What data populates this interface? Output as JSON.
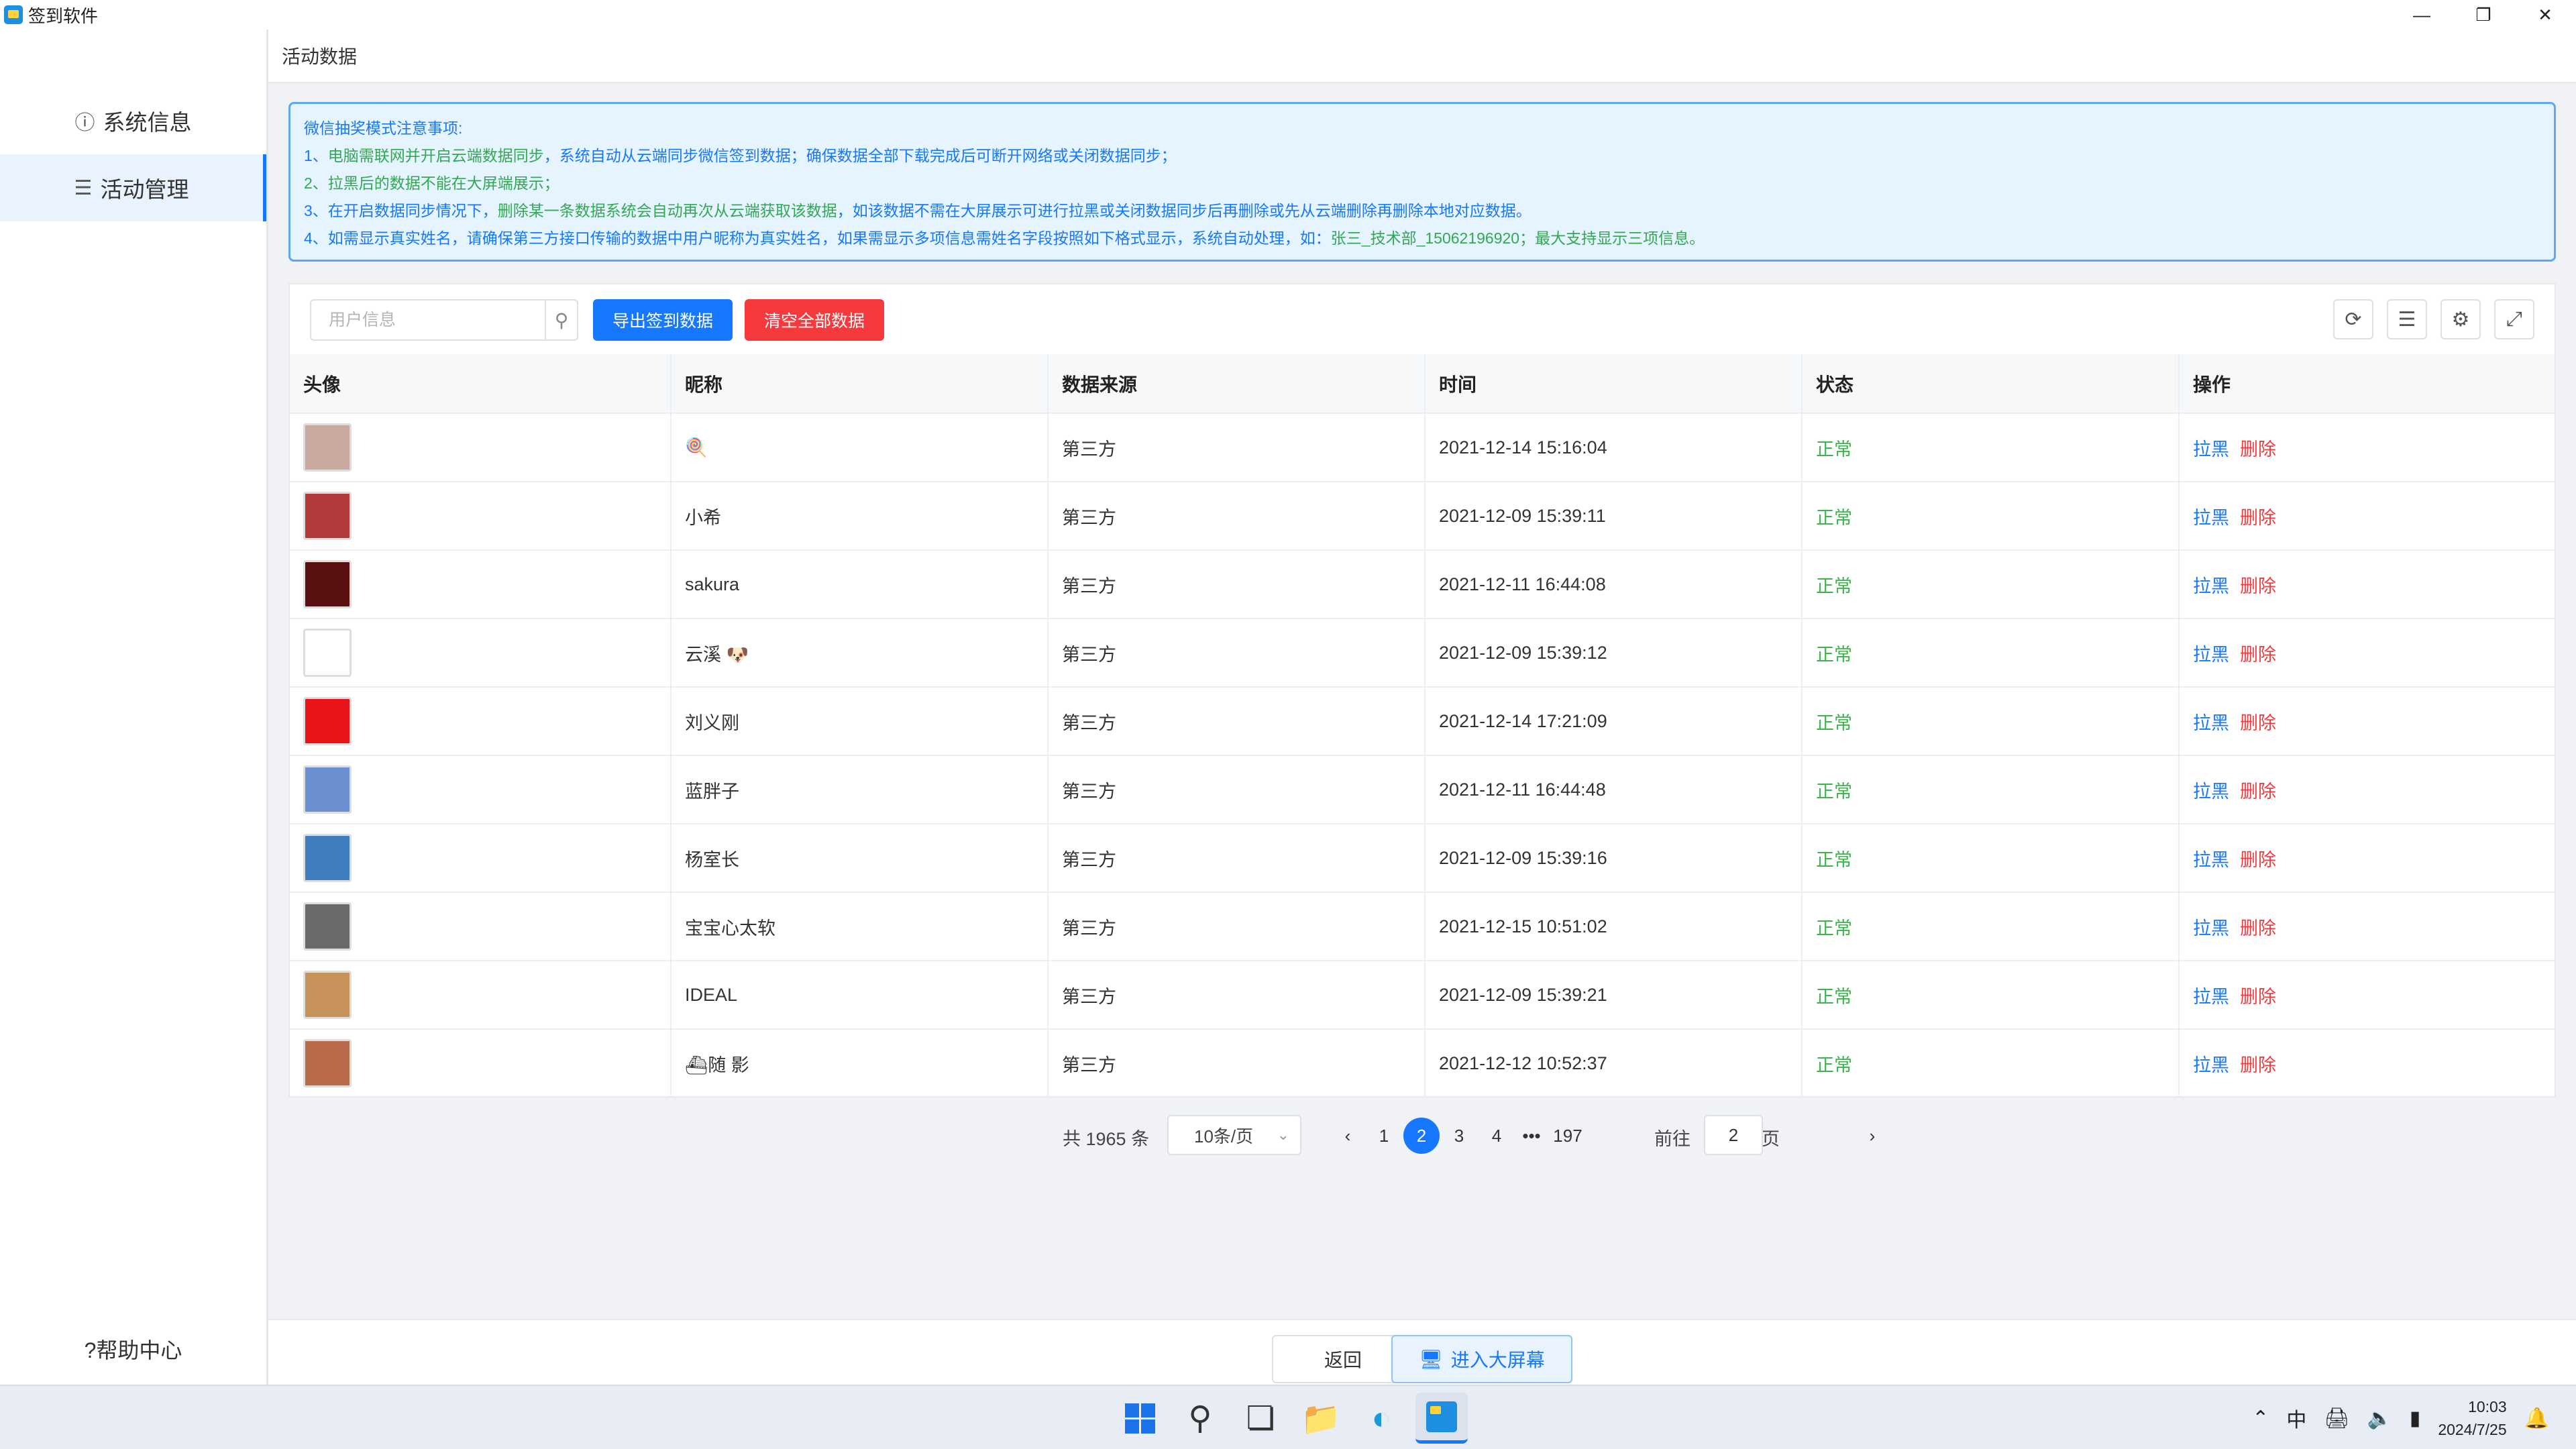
{
  "app": {
    "title": "签到软件"
  },
  "sidebar": {
    "items": [
      {
        "label": "系统信息",
        "icon": "info-icon"
      },
      {
        "label": "活动管理",
        "icon": "list-icon"
      }
    ],
    "help": "?帮助中心"
  },
  "breadcrumb": "活动数据",
  "notice": {
    "title": "微信抽奖模式注意事项:",
    "line1_a": "1、",
    "line1_b": "电脑需联网并开启云端数据同步",
    "line1_c": "，系统自动从云端同步微信签到数据；确保数据全部下载完成后可断开网络或关闭数据同步；",
    "line2": "2、拉黑后的数据不能在大屏端展示；",
    "line3_a": "3、在开启数据同步情况下，",
    "line3_b": "删除某一条数据系统会自动再次从云端获取该数据",
    "line3_c": "，如该数据不需在大屏展示可进行拉黑或关闭数据同步后再删除或先从云端删除再删除本地对应数据。",
    "line4_a": "4、如需显示真实姓名，请确保第三方接口传输的数据中用户昵称为真实姓名，如果需显示多项信息需姓名字段按照如下格式显示，系统自动处理，如：",
    "line4_b": "张三_技术部_15062196920；最大支持显示三项信息。"
  },
  "toolbar": {
    "search_placeholder": "用户信息",
    "export_label": "导出签到数据",
    "clear_label": "清空全部数据"
  },
  "table": {
    "headers": [
      "头像",
      "昵称",
      "数据来源",
      "时间",
      "状态",
      "操作"
    ],
    "action_black": "拉黑",
    "action_delete": "删除",
    "rows": [
      {
        "nickname": "🍭",
        "source": "第三方",
        "time": "2021-12-14 15:16:04",
        "status": "正常",
        "avatar_color": "#c9a9a0"
      },
      {
        "nickname": "小希",
        "source": "第三方",
        "time": "2021-12-09 15:39:11",
        "status": "正常",
        "avatar_color": "#b23a3a"
      },
      {
        "nickname": "sakura",
        "source": "第三方",
        "time": "2021-12-11 16:44:08",
        "status": "正常",
        "avatar_color": "#5a1010"
      },
      {
        "nickname": "云溪 🐶",
        "source": "第三方",
        "time": "2021-12-09 15:39:12",
        "status": "正常",
        "avatar_color": "#ffffff"
      },
      {
        "nickname": "刘义刚",
        "source": "第三方",
        "time": "2021-12-14 17:21:09",
        "status": "正常",
        "avatar_color": "#e8141a"
      },
      {
        "nickname": "蓝胖子",
        "source": "第三方",
        "time": "2021-12-11 16:44:48",
        "status": "正常",
        "avatar_color": "#6a8fd0"
      },
      {
        "nickname": "杨室长",
        "source": "第三方",
        "time": "2021-12-09 15:39:16",
        "status": "正常",
        "avatar_color": "#3f7fc0"
      },
      {
        "nickname": "宝宝心太软",
        "source": "第三方",
        "time": "2021-12-15 10:51:02",
        "status": "正常",
        "avatar_color": "#6a6a6a"
      },
      {
        "nickname": "IDEAL",
        "source": "第三方",
        "time": "2021-12-09 15:39:21",
        "status": "正常",
        "avatar_color": "#c8935a"
      },
      {
        "nickname": "⛴随 影",
        "source": "第三方",
        "time": "2021-12-12 10:52:37",
        "status": "正常",
        "avatar_color": "#b86a4a"
      }
    ]
  },
  "pagination": {
    "total": "共 1965 条",
    "page_size": "10条/页",
    "prev": "‹",
    "next": "›",
    "pages": [
      "1",
      "2",
      "3",
      "4",
      "•••",
      "197"
    ],
    "current": "2",
    "goto_label": "前往",
    "goto_value": "2",
    "page_suffix": "页"
  },
  "footer": {
    "back_label": "返回",
    "bigscreen_label": "进入大屏幕"
  },
  "taskbar": {
    "ime": "中",
    "time": "10:03",
    "date": "2024/7/25"
  }
}
